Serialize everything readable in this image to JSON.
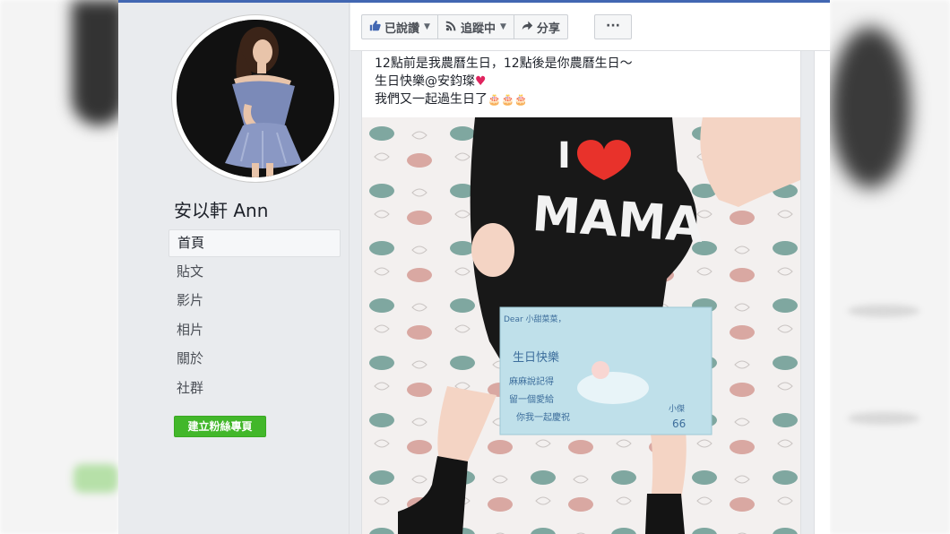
{
  "page": {
    "name": "安以軒 Ann"
  },
  "nav": {
    "items": [
      {
        "label": "首頁",
        "active": true
      },
      {
        "label": "貼文"
      },
      {
        "label": "影片"
      },
      {
        "label": "相片"
      },
      {
        "label": "關於"
      },
      {
        "label": "社群"
      }
    ],
    "create_page_label": "建立粉絲專頁"
  },
  "actions": {
    "liked_label": "已說讚",
    "following_label": "追蹤中",
    "share_label": "分享",
    "more_label": "···",
    "liked_icon": "thumbs-up-icon",
    "following_icon": "rss-icon",
    "share_icon": "share-arrow-icon"
  },
  "post": {
    "line1": "12點前是我農曆生日，12點後是你農曆生日～",
    "line2": "生日快樂@安鈞璨",
    "line2_emoji": "♥",
    "line3": "我們又一起過生日了",
    "line3_emoji": "🎂🎂🎂"
  },
  "photo": {
    "shirt_line1": "I",
    "shirt_line2": "MAMA",
    "card_greeting": "Dear 小甜菜菜，",
    "card_line1": "生日快樂",
    "card_line2": "麻麻說記得",
    "card_line3": "留一個愛給",
    "card_line4": "你我一起慶祝",
    "card_sign1": "小傑",
    "card_sign2": "66"
  },
  "colors": {
    "brand_blue": "#4267b2",
    "create_green": "#42b72a",
    "heart_red": "#e0245e"
  }
}
